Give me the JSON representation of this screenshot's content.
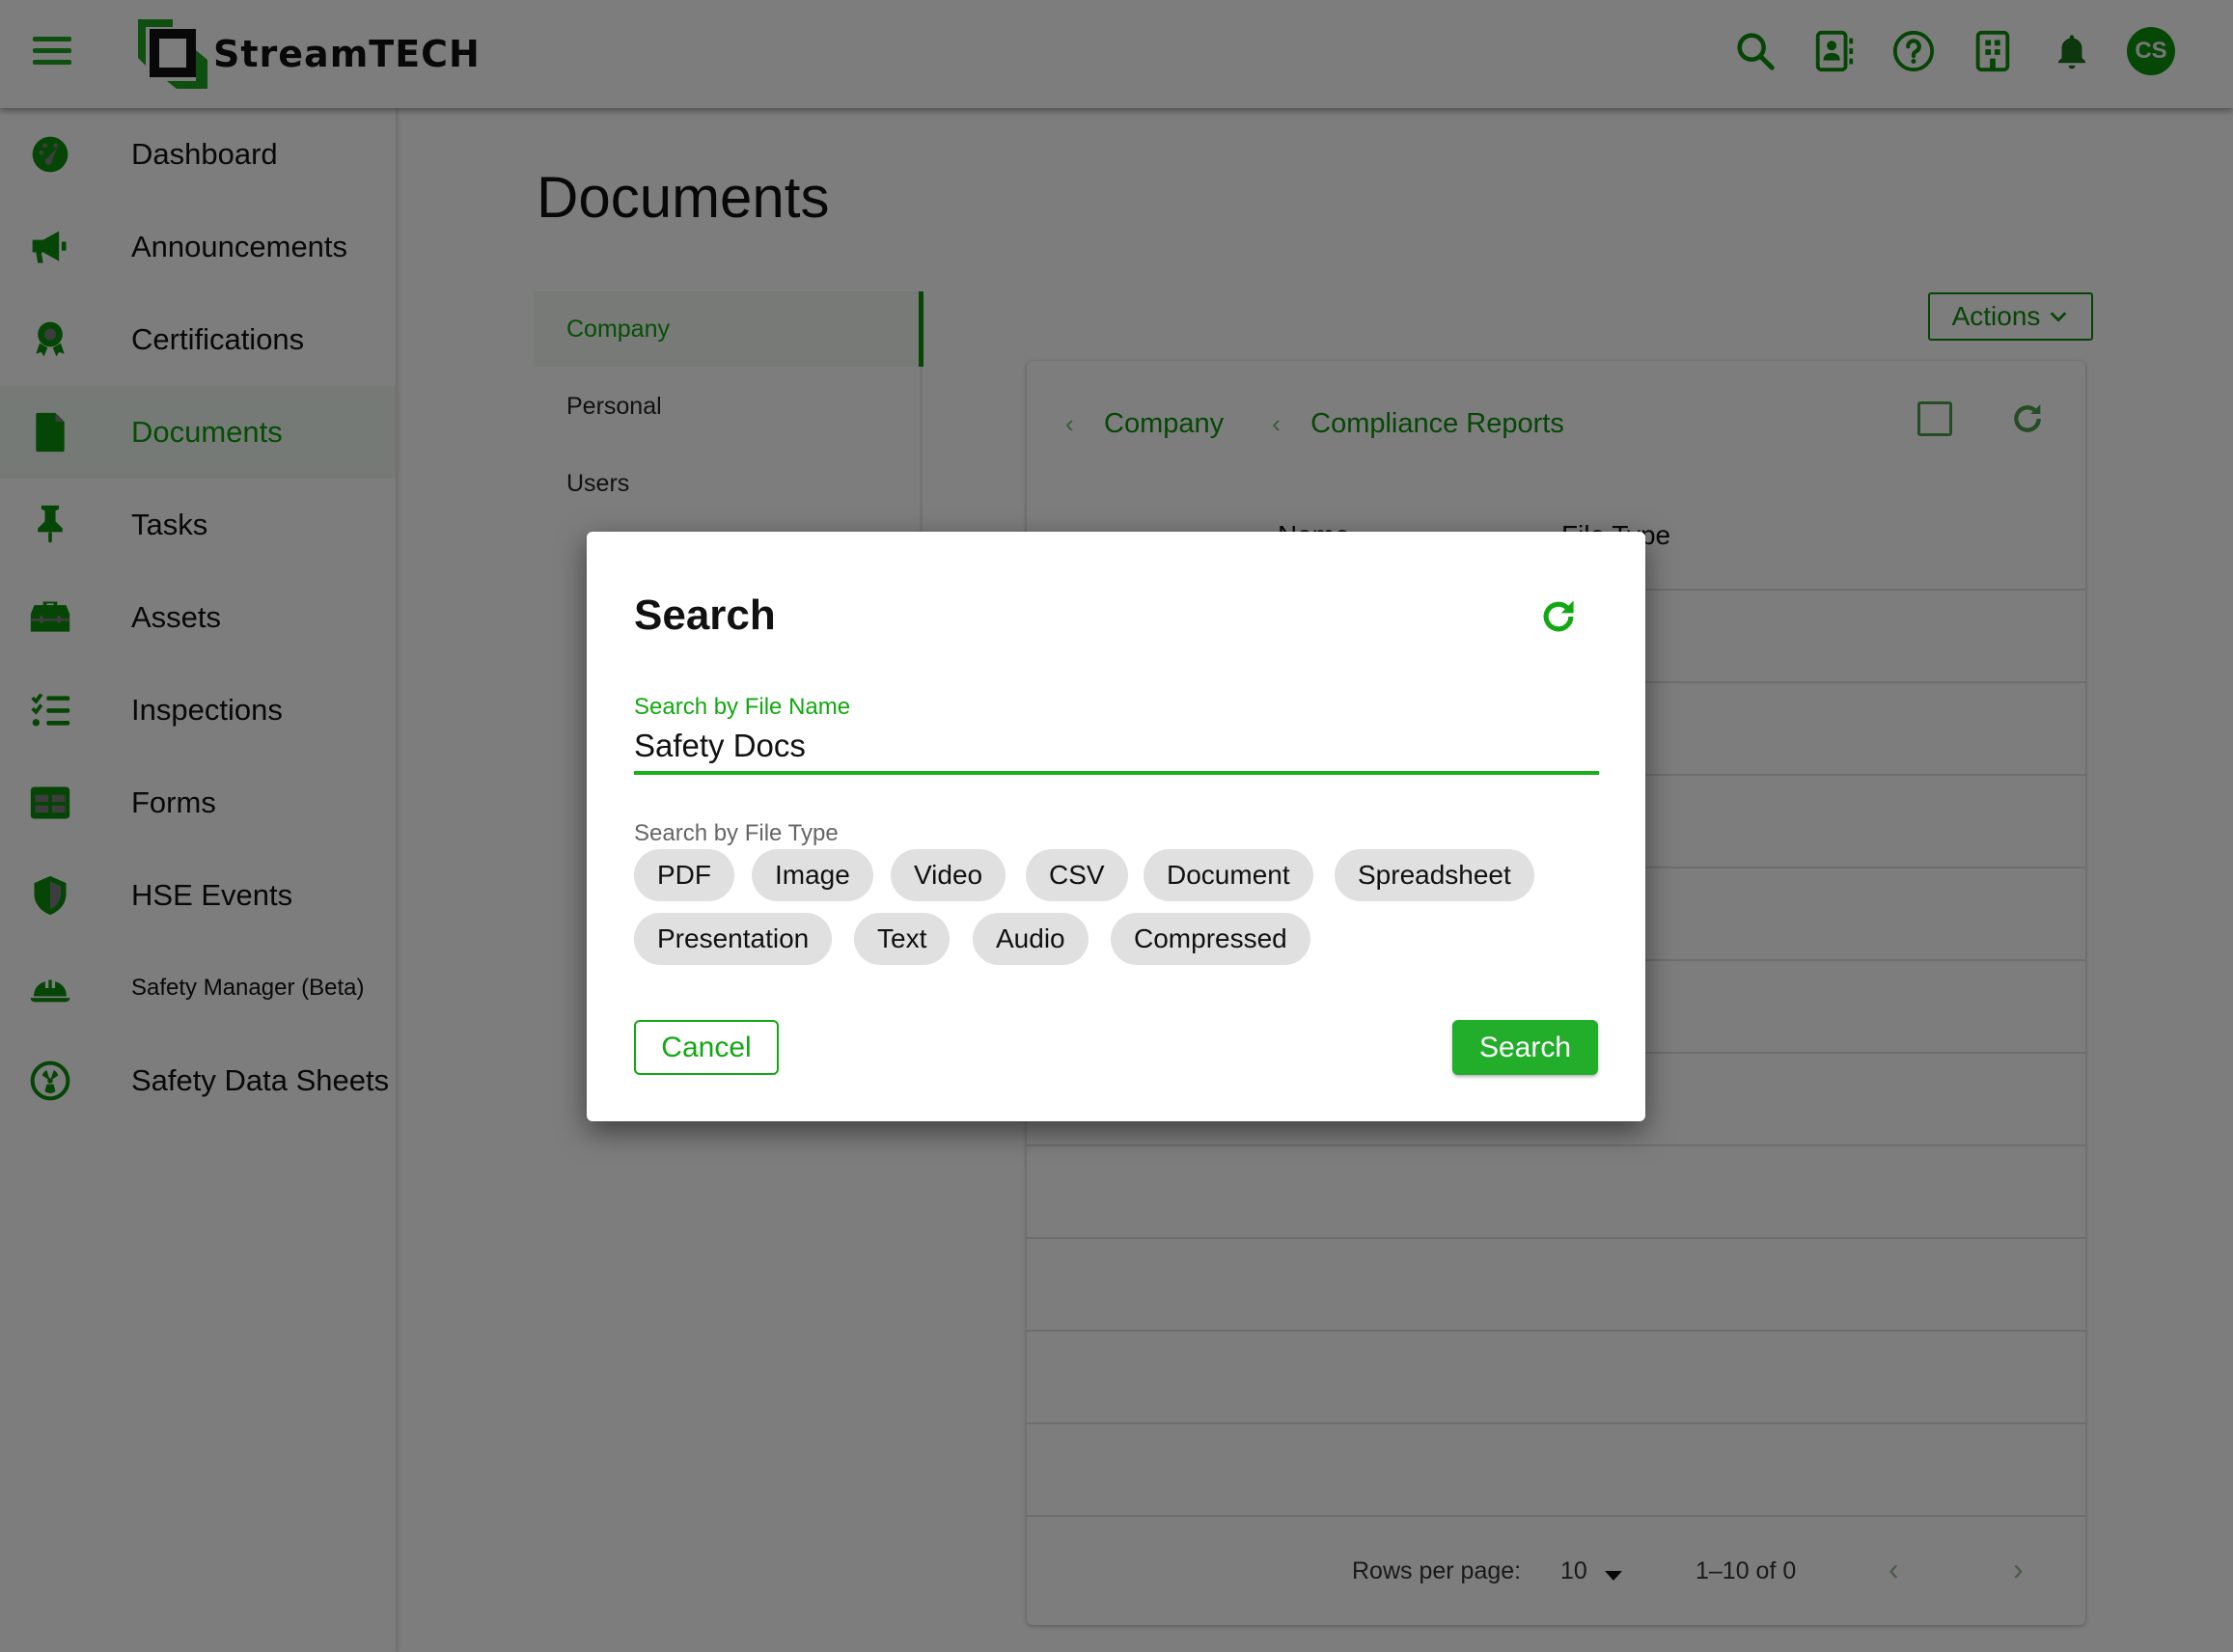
{
  "app": {
    "brand_name": "StreamTECH",
    "accent_color": "#0a9a0a",
    "user_initials": "CS",
    "top_icons": [
      "search-icon",
      "contacts-icon",
      "help-icon",
      "building-icon",
      "bell-icon"
    ]
  },
  "sidebar": {
    "items": [
      {
        "label": "Dashboard",
        "icon": "dashboard-gauge-icon"
      },
      {
        "label": "Announcements",
        "icon": "megaphone-icon"
      },
      {
        "label": "Certifications",
        "icon": "award-icon"
      },
      {
        "label": "Documents",
        "icon": "document-icon",
        "active": true
      },
      {
        "label": "Tasks",
        "icon": "pushpin-icon"
      },
      {
        "label": "Assets",
        "icon": "toolbox-icon"
      },
      {
        "label": "Inspections",
        "icon": "checklist-icon"
      },
      {
        "label": "Forms",
        "icon": "table-icon"
      },
      {
        "label": "HSE Events",
        "icon": "shield-icon"
      },
      {
        "label": "Safety Manager (Beta)",
        "icon": "hard-hat-icon"
      },
      {
        "label": "Safety Data Sheets",
        "icon": "radiation-icon"
      }
    ]
  },
  "main": {
    "title": "Documents",
    "tabs": [
      {
        "label": "Company",
        "active": true
      },
      {
        "label": "Personal"
      },
      {
        "label": "Users"
      }
    ],
    "actions_label": "Actions",
    "breadcrumbs": [
      "Company",
      "Compliance Reports"
    ],
    "table": {
      "columns": [
        "Name",
        "File Type"
      ],
      "rows": []
    },
    "pagination": {
      "rows_per_page_label": "Rows per page:",
      "rows_per_page": "10",
      "range": "1–10 of 0"
    }
  },
  "dialog": {
    "title": "Search",
    "file_name_label": "Search by File Name",
    "file_name_value": "Safety Docs",
    "file_type_label": "Search by File Type",
    "file_types": [
      "PDF",
      "Image",
      "Video",
      "CSV",
      "Document",
      "Spreadsheet",
      "Presentation",
      "Text",
      "Audio",
      "Compressed"
    ],
    "cancel_label": "Cancel",
    "search_label": "Search"
  }
}
